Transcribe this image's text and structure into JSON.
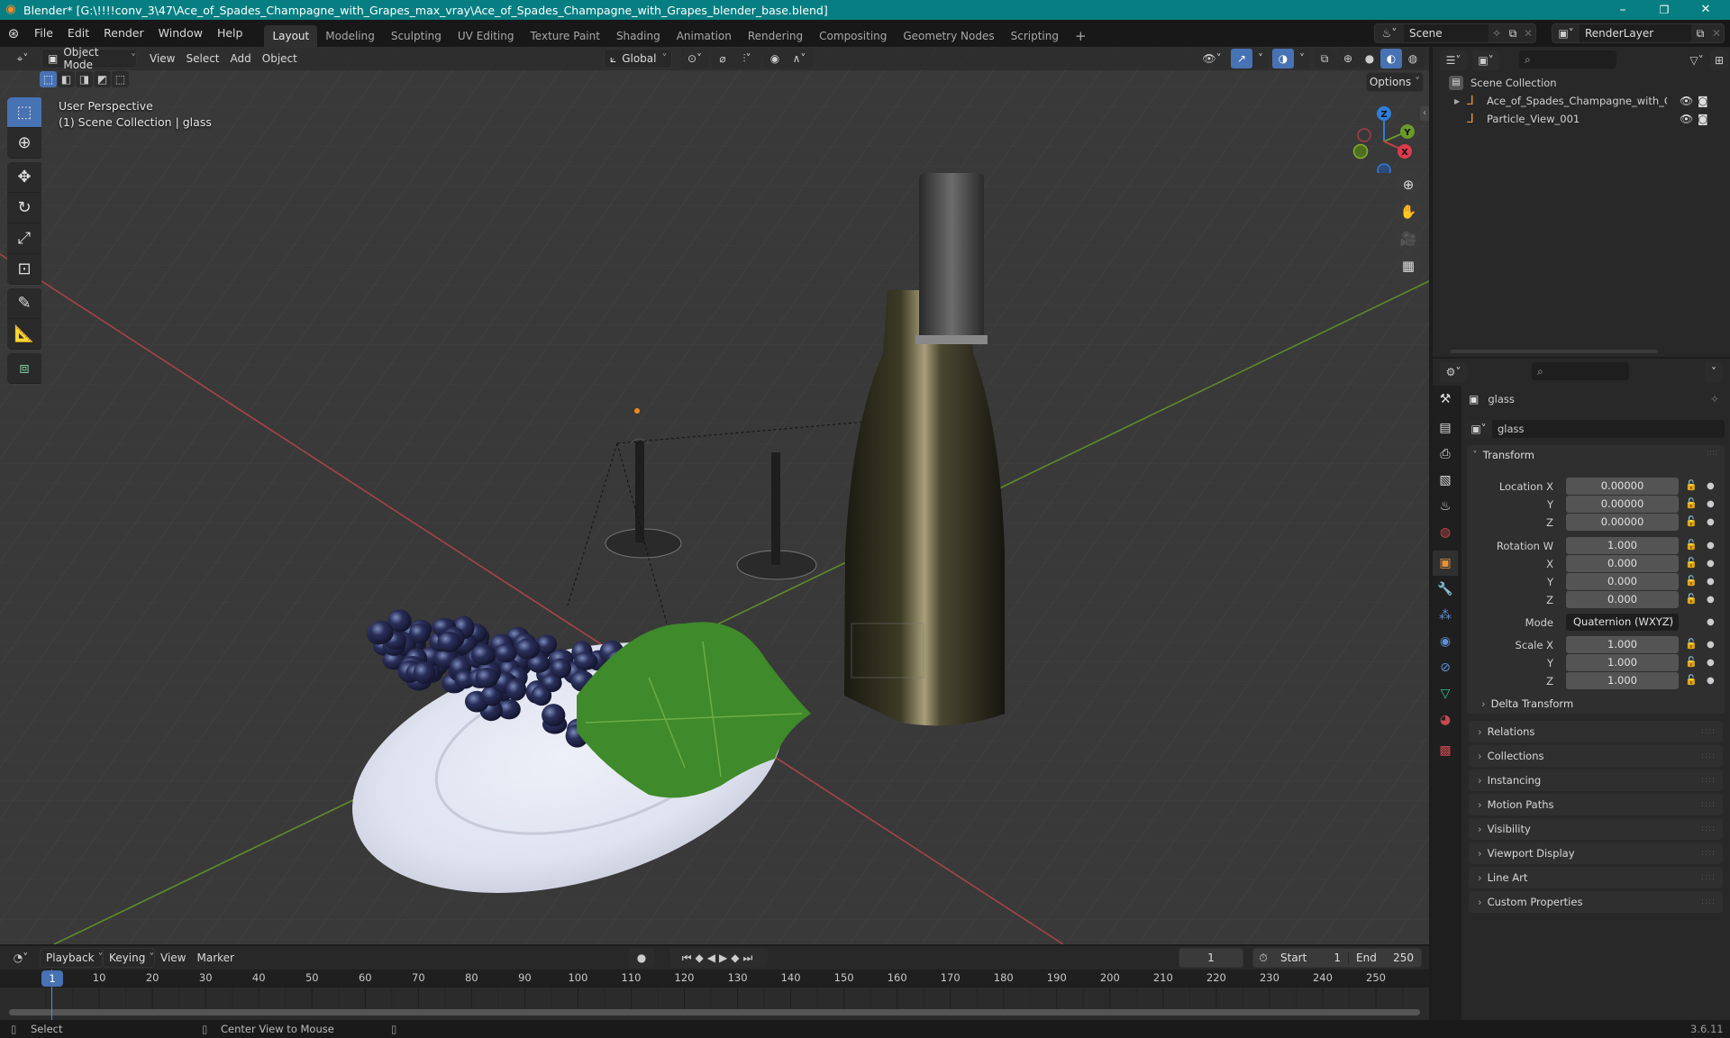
{
  "titlebar": {
    "title": "Blender* [G:\\!!!!conv_3\\47\\Ace_of_Spades_Champagne_with_Grapes_max_vray\\Ace_of_Spades_Champagne_with_Grapes_blender_base.blend]",
    "minimize": "–",
    "maximize": "❐",
    "close": "✕"
  },
  "menubar": {
    "menus": [
      "File",
      "Edit",
      "Render",
      "Window",
      "Help"
    ],
    "workspaces": [
      "Layout",
      "Modeling",
      "Sculpting",
      "UV Editing",
      "Texture Paint",
      "Shading",
      "Animation",
      "Rendering",
      "Compositing",
      "Geometry Nodes",
      "Scripting"
    ],
    "active_workspace": "Layout",
    "add_workspace": "+",
    "scene_label": "Scene",
    "view_layer_label": "RenderLayer"
  },
  "viewport": {
    "mode": "Object Mode",
    "menus": [
      "View",
      "Select",
      "Add",
      "Object"
    ],
    "transform_orientation": "Global",
    "options_label": "Options",
    "overlay_line1": "User Perspective",
    "overlay_line2": "(1) Scene Collection | glass",
    "gizmo": {
      "x": "X",
      "y": "Y",
      "z": "Z"
    },
    "colors": {
      "x_axis": "#c2404a",
      "y_axis": "#6a9a2a",
      "z_axis": "#2e7fd9",
      "grid_bg": "#393939"
    }
  },
  "outliner": {
    "search_placeholder": "",
    "root": "Scene Collection",
    "items": [
      {
        "name": "Ace_of_Spades_Champagne_with_Grapes",
        "expandable": true
      },
      {
        "name": "Particle_View_001",
        "expandable": false
      }
    ]
  },
  "properties": {
    "object_name": "glass",
    "data_name": "glass",
    "transform_label": "Transform",
    "location": {
      "label": "Location X",
      "x": "0.00000",
      "y": "0.00000",
      "z": "0.00000"
    },
    "rotation": {
      "label": "Rotation W",
      "w": "1.000",
      "x": "0.000",
      "y": "0.000",
      "z": "0.000"
    },
    "mode_label": "Mode",
    "mode_value": "Quaternion (WXYZ)",
    "scale": {
      "label": "Scale X",
      "x": "1.000",
      "y": "1.000",
      "z": "1.000"
    },
    "axis_labels": {
      "y": "Y",
      "z": "Z",
      "x": "X"
    },
    "delta_transform": "Delta Transform",
    "panels": [
      "Relations",
      "Collections",
      "Instancing",
      "Motion Paths",
      "Visibility",
      "Viewport Display",
      "Line Art",
      "Custom Properties"
    ]
  },
  "timeline": {
    "menus": [
      "Playback",
      "Keying",
      "View",
      "Marker"
    ],
    "current_frame": "1",
    "start_label": "Start",
    "start_value": "1",
    "end_label": "End",
    "end_value": "250",
    "ticks": [
      "10",
      "20",
      "30",
      "40",
      "50",
      "60",
      "70",
      "80",
      "90",
      "100",
      "110",
      "120",
      "130",
      "140",
      "150",
      "160",
      "170",
      "180",
      "190",
      "200",
      "210",
      "220",
      "230",
      "240",
      "250"
    ],
    "playhead": "1"
  },
  "statusbar": {
    "select": "Select",
    "center_view": "Center View to Mouse",
    "version": "3.6.11"
  }
}
